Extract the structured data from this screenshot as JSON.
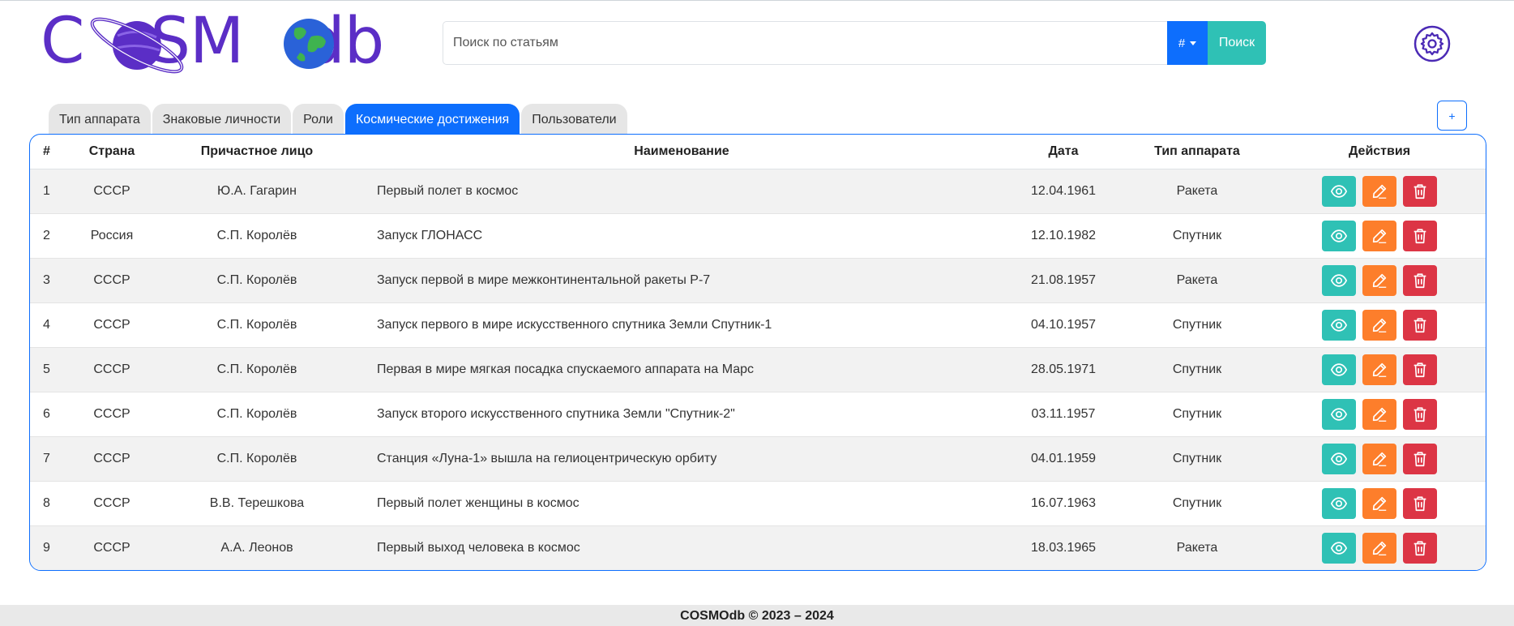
{
  "brand": {
    "logo_text_before": "C",
    "logo_text_middle": "SM",
    "logo_text_after": "db",
    "logo_text_color": "#5b2ec6"
  },
  "search": {
    "placeholder": "Поиск по статьям",
    "value": "",
    "filter_label": "#",
    "button_label": "Поиск"
  },
  "settings_icon": "gear-icon",
  "tabs": [
    {
      "label": "Тип аппарата",
      "active": false
    },
    {
      "label": "Знаковые личности",
      "active": false
    },
    {
      "label": "Роли",
      "active": false
    },
    {
      "label": "Космические достижения",
      "active": true
    },
    {
      "label": "Пользователи",
      "active": false
    }
  ],
  "add_button_label": "+",
  "table": {
    "headers": [
      "#",
      "Страна",
      "Причастное лицо",
      "Наименование",
      "Дата",
      "Тип аппарата",
      "Действия"
    ],
    "rows": [
      [
        "1",
        "СССР",
        "Ю.А. Гагарин",
        "Первый полет в космос",
        "12.04.1961",
        "Ракета"
      ],
      [
        "2",
        "Россия",
        "С.П. Королёв",
        "Запуск ГЛОНАСС",
        "12.10.1982",
        "Спутник"
      ],
      [
        "3",
        "СССР",
        "С.П. Королёв",
        "Запуск первой в мире межконтинентальной ракеты Р-7",
        "21.08.1957",
        "Ракета"
      ],
      [
        "4",
        "СССР",
        "С.П. Королёв",
        "Запуск первого в мире искусственного спутника Земли Спутник-1",
        "04.10.1957",
        "Спутник"
      ],
      [
        "5",
        "СССР",
        "С.П. Королёв",
        "Первая в мире мягкая посадка спускаемого аппарата на Марс",
        "28.05.1971",
        "Спутник"
      ],
      [
        "6",
        "СССР",
        "С.П. Королёв",
        "Запуск второго искусственного спутника Земли \"Спутник-2\"",
        "03.11.1957",
        "Спутник"
      ],
      [
        "7",
        "СССР",
        "С.П. Королёв",
        "Станция «Луна-1» вышла на гелиоцентрическую орбиту",
        "04.01.1959",
        "Спутник"
      ],
      [
        "8",
        "СССР",
        "В.В. Терешкова",
        "Первый полет женщины в космос",
        "16.07.1963",
        "Спутник"
      ],
      [
        "9",
        "СССР",
        "А.А. Леонов",
        "Первый выход человека в космос",
        "18.03.1965",
        "Ракета"
      ]
    ],
    "row_actions": [
      "eye-icon",
      "pencil-icon",
      "trash-icon"
    ]
  },
  "colors": {
    "primary": "#0d6efd",
    "teal": "#2fc1b5",
    "orange": "#fd7e2b",
    "red": "#dc3545"
  },
  "footer": {
    "text": "COSMOdb © 2023 – 2024"
  }
}
